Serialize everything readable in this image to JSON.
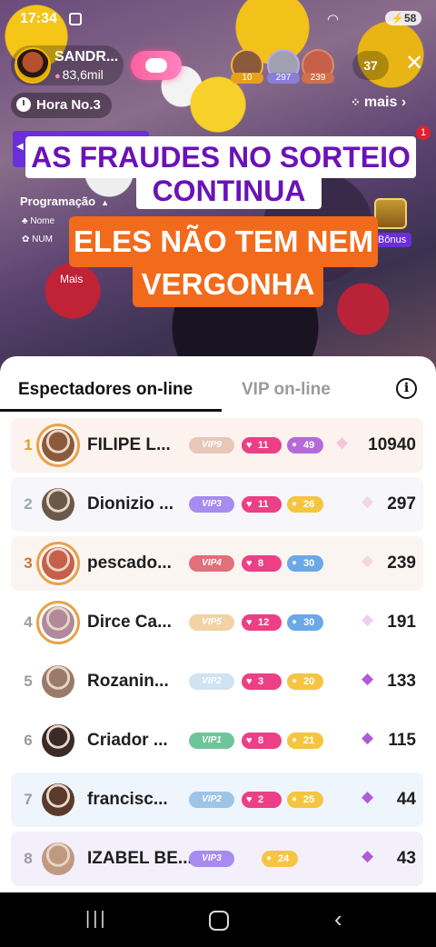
{
  "status": {
    "time": "17:34",
    "battery": "58"
  },
  "host": {
    "name": "SANDR...",
    "likes": "83,6mil"
  },
  "top_viewers": [
    {
      "badge": "10",
      "color": "#f3b63a"
    },
    {
      "badge": "297",
      "color": "#9a8fd8"
    },
    {
      "badge": "239",
      "color": "#d07a5a"
    }
  ],
  "viewer_count": "37",
  "hour_label": "Hora No.3",
  "mais_label": "mais",
  "notif_count": "1",
  "side_panel": {
    "programacao": "Programação",
    "row1": "Nome",
    "row2": "NUM",
    "mais": "Mais",
    "bonus": "Bônus"
  },
  "captions": {
    "line1": "AS FRAUDES NO SORTEIO",
    "line2": "CONTINUA",
    "line3": "ELES NÃO TEM NEM",
    "line4": "VERGONHA"
  },
  "tabs": {
    "active": "Espectadores on-line",
    "inactive": "VIP on-line"
  },
  "viewers": [
    {
      "rank": "1",
      "name": "FILIPE L...",
      "vip": "VIP9",
      "vip_color": "#e8c6b8",
      "hearts": "11",
      "level": "49",
      "level_color": "#b56ad8",
      "score": "10940",
      "row_bg": "#fdf3ee",
      "rank_color": "#e0a020",
      "gem_color": "#f4c6d8",
      "avatar": "#8a5a3a",
      "frame": true
    },
    {
      "rank": "2",
      "name": "Dionizio ...",
      "vip": "VIP3",
      "vip_color": "#a78bf0",
      "hearts": "11",
      "level": "26",
      "level_color": "#f5c542",
      "score": "297",
      "row_bg": "#f6f6fb",
      "rank_color": "#a0a6b8",
      "gem_color": "#f4d6e0",
      "avatar": "#6a5848",
      "frame": false
    },
    {
      "rank": "3",
      "name": "pescado...",
      "vip": "VIP4",
      "vip_color": "#e0707a",
      "hearts": "8",
      "level": "30",
      "level_color": "#6aa8e8",
      "score": "239",
      "row_bg": "#fbf5f2",
      "rank_color": "#c8763a",
      "gem_color": "#f4d6e0",
      "avatar": "#c7604a",
      "frame": true
    },
    {
      "rank": "4",
      "name": "Dirce Ca...",
      "vip": "VIP5",
      "vip_color": "#f1d3a6",
      "hearts": "12",
      "level": "30",
      "level_color": "#6aa8e8",
      "score": "191",
      "row_bg": "#ffffff",
      "rank_color": "#9a9aa0",
      "gem_color": "#ead0ee",
      "avatar": "#b08a9a",
      "frame": true
    },
    {
      "rank": "5",
      "name": "Rozanin...",
      "vip": "VIP2",
      "vip_color": "#cfe3f2",
      "hearts": "3",
      "level": "20",
      "level_color": "#f5c542",
      "score": "133",
      "row_bg": "#ffffff",
      "rank_color": "#9a9aa0",
      "gem_color": "#b05ad8",
      "avatar": "#9a7a6a",
      "frame": false
    },
    {
      "rank": "6",
      "name": "Criador ...",
      "vip": "VIP1",
      "vip_color": "#6fc59a",
      "hearts": "8",
      "level": "21",
      "level_color": "#f5c542",
      "score": "115",
      "row_bg": "#ffffff",
      "rank_color": "#9a9aa0",
      "gem_color": "#b05ad8",
      "avatar": "#3a2a28",
      "frame": false
    },
    {
      "rank": "7",
      "name": "francisc...",
      "vip": "VIP2",
      "vip_color": "#9ec4e8",
      "hearts": "2",
      "level": "25",
      "level_color": "#f5c542",
      "score": "44",
      "row_bg": "#eef5fd",
      "rank_color": "#9a9aa0",
      "gem_color": "#b05ad8",
      "avatar": "#5a3a2a",
      "frame": false
    },
    {
      "rank": "8",
      "name": "IZABEL BE...",
      "vip": "VIP3",
      "vip_color": "#a78bf0",
      "hearts": "",
      "level": "24",
      "level_color": "#f5c542",
      "score": "43",
      "row_bg": "#f3f0fb",
      "rank_color": "#9a9aa0",
      "gem_color": "#b05ad8",
      "avatar": "#c09a80",
      "frame": false
    }
  ]
}
